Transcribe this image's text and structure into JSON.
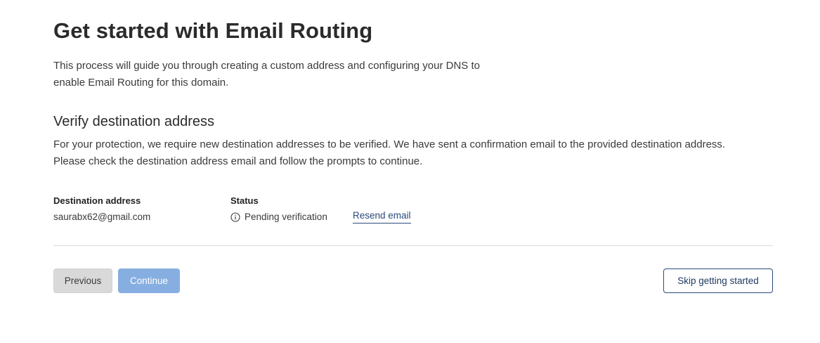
{
  "page": {
    "title": "Get started with Email Routing",
    "intro_line1": "This process will guide you through creating a custom address and configuring your DNS to",
    "intro_line2": "enable Email Routing for this domain."
  },
  "verify": {
    "heading": "Verify destination address",
    "desc_line1": "For your protection, we require new destination addresses to be verified. We have sent a confirmation email to the provided destination address.",
    "desc_line2": "Please check the destination address email and follow the prompts to continue."
  },
  "details": {
    "destination_label": "Destination address",
    "destination_value": "saurabx62@gmail.com",
    "status_label": "Status",
    "status_value": "Pending verification",
    "status_icon": "info-circle-icon",
    "resend_label": "Resend email"
  },
  "actions": {
    "previous_label": "Previous",
    "continue_label": "Continue",
    "continue_state": "disabled",
    "skip_label": "Skip getting started"
  },
  "colors": {
    "link": "#2c4a7a",
    "continue_disabled_bg": "#86aee0",
    "previous_bg": "#d9d9d9",
    "skip_border": "#2c4a7a",
    "divider": "#d9d9d9"
  }
}
